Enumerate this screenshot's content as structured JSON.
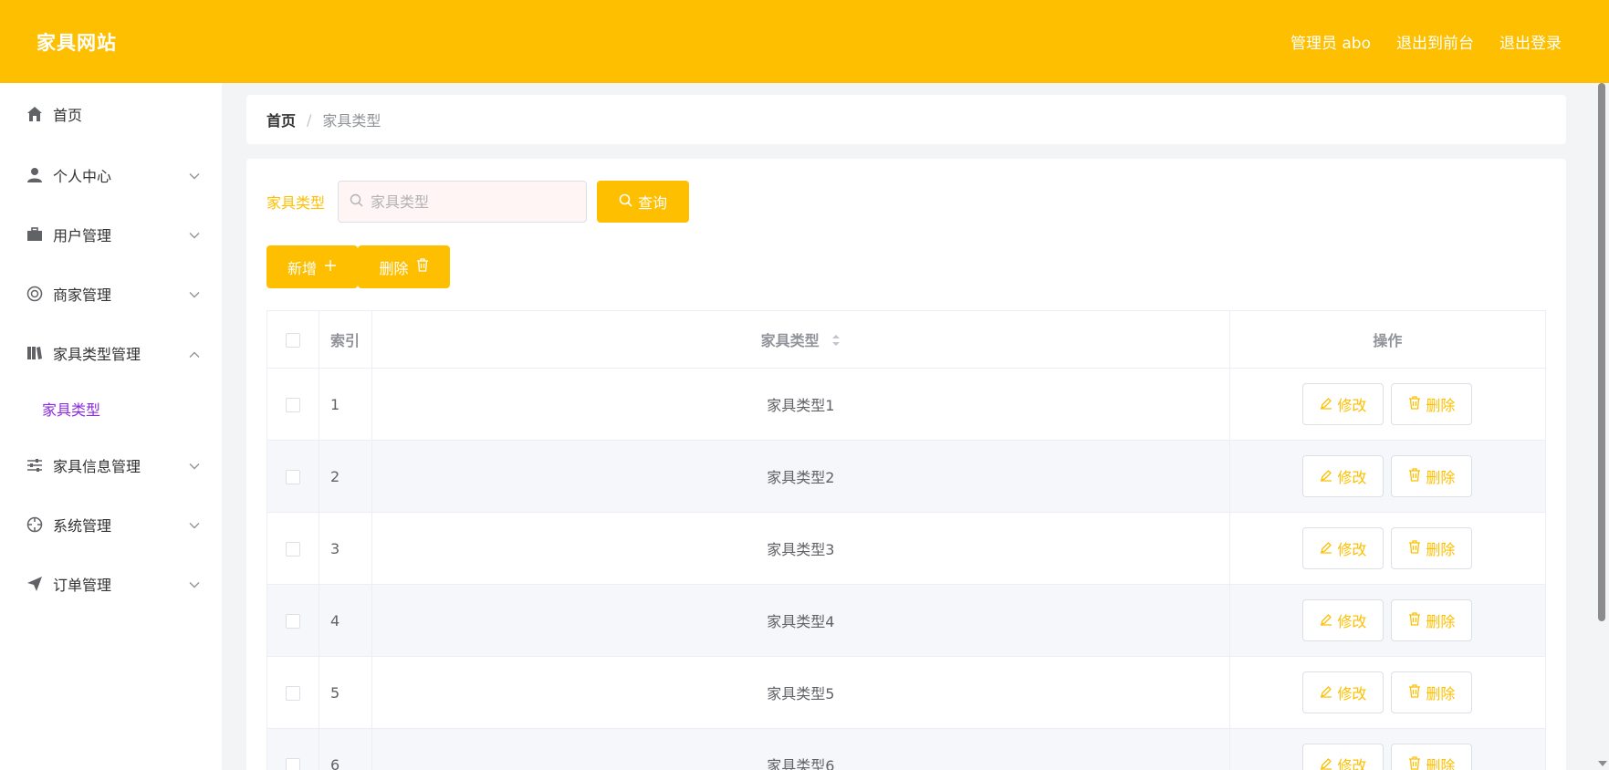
{
  "header": {
    "brand": "家具网站",
    "user": "管理员 abo",
    "front_link": "退出到前台",
    "logout_link": "退出登录"
  },
  "sidebar": {
    "items": [
      {
        "label": "首页",
        "icon": "home-icon"
      },
      {
        "label": "个人中心",
        "icon": "user-icon"
      },
      {
        "label": "用户管理",
        "icon": "briefcase-icon"
      },
      {
        "label": "商家管理",
        "icon": "lifebuoy-icon"
      },
      {
        "label": "家具类型管理",
        "icon": "book-icon"
      },
      {
        "label": "家具信息管理",
        "icon": "sliders-icon"
      },
      {
        "label": "系统管理",
        "icon": "crosshair-icon"
      },
      {
        "label": "订单管理",
        "icon": "send-icon"
      }
    ],
    "active_sub": "家具类型"
  },
  "breadcrumb": {
    "home": "首页",
    "separator": "/",
    "current": "家具类型"
  },
  "search": {
    "label": "家具类型",
    "placeholder": "家具类型",
    "query_label": "查询"
  },
  "actions": {
    "add_label": "新增",
    "delete_label": "删除"
  },
  "table": {
    "headers": {
      "index": "索引",
      "type": "家具类型",
      "ops": "操作"
    },
    "edit_label": "修改",
    "delete_label": "删除",
    "rows": [
      {
        "index": "1",
        "type": "家具类型1"
      },
      {
        "index": "2",
        "type": "家具类型2"
      },
      {
        "index": "3",
        "type": "家具类型3"
      },
      {
        "index": "4",
        "type": "家具类型4"
      },
      {
        "index": "5",
        "type": "家具类型5"
      },
      {
        "index": "6",
        "type": "家具类型6"
      }
    ]
  },
  "colors": {
    "accent": "#fdbf00",
    "sub_active": "#8a2be2"
  }
}
